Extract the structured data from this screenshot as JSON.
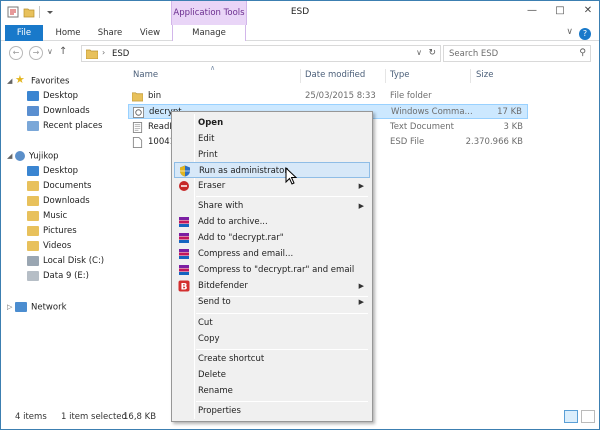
{
  "window": {
    "title": "ESD",
    "context_tab_header": "Application Tools"
  },
  "ribbon": {
    "tabs": [
      "File",
      "Home",
      "Share",
      "View",
      "Manage"
    ],
    "help": "?"
  },
  "address": {
    "crumb": "ESD",
    "search_placeholder": "Search ESD"
  },
  "nav_pane": {
    "favorites": "Favorites",
    "favorites_items": [
      "Desktop",
      "Downloads",
      "Recent places"
    ],
    "user": "Yujikop",
    "user_items": [
      "Desktop",
      "Documents",
      "Downloads",
      "Music",
      "Pictures",
      "Videos",
      "Local Disk (C:)",
      "Data 9 (E:)"
    ],
    "network": "Network"
  },
  "columns": {
    "name": "Name",
    "date": "Date modified",
    "type": "Type",
    "size": "Size"
  },
  "files": [
    {
      "name": "bin",
      "date": "25/03/2015 8:33",
      "type": "File folder",
      "size": ""
    },
    {
      "name": "decrypt",
      "date": "",
      "type": "Windows Comma...",
      "size": "17 KB"
    },
    {
      "name": "ReadM",
      "date": "",
      "type": "Text Document",
      "size": "3 KB"
    },
    {
      "name": "10041.",
      "date": "",
      "type": "ESD File",
      "size": "2.370.966 KB"
    }
  ],
  "status": {
    "items": "4 items",
    "selected": "1 item selected",
    "size": "16,8 KB"
  },
  "context_menu": {
    "open": "Open",
    "edit": "Edit",
    "print": "Print",
    "run_as_admin": "Run as administrator",
    "eraser": "Eraser",
    "share_with": "Share with",
    "add_archive": "Add to archive...",
    "add_rar": "Add to \"decrypt.rar\"",
    "compress_email": "Compress and email...",
    "compress_rar_email": "Compress to \"decrypt.rar\" and email",
    "bitdefender": "Bitdefender",
    "send_to": "Send to",
    "cut": "Cut",
    "copy": "Copy",
    "create_shortcut": "Create shortcut",
    "delete": "Delete",
    "rename": "Rename",
    "properties": "Properties"
  },
  "colors": {
    "accent": "#1979ca",
    "selection": "#cce8ff",
    "context_tab": "#e9d5f7",
    "folder": "#e8c15c"
  }
}
